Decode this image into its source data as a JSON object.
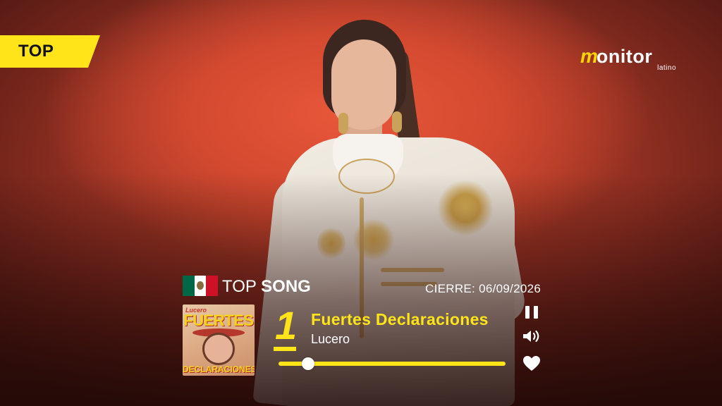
{
  "badge": {
    "label": "TOP"
  },
  "logo": {
    "m": "m",
    "rest": "onitor",
    "sub": "latino"
  },
  "header": {
    "country_flag": "mexico-flag-icon",
    "top_label": "TOP",
    "song_label": "SONG",
    "cierre": "CIERRE: 06/09/2026"
  },
  "cover": {
    "artist": "Lucero",
    "title_line1": "FUERTES",
    "title_line2": "DECLARACIONES"
  },
  "track": {
    "rank": "1",
    "title": "Fuertes Declaraciones",
    "artist": "Lucero",
    "progress": 0.13
  },
  "controls": {
    "pause": "pause-icon",
    "volume": "volume-icon",
    "like": "heart-icon"
  },
  "colors": {
    "accent": "#ffe419",
    "background": "#d44a30"
  }
}
